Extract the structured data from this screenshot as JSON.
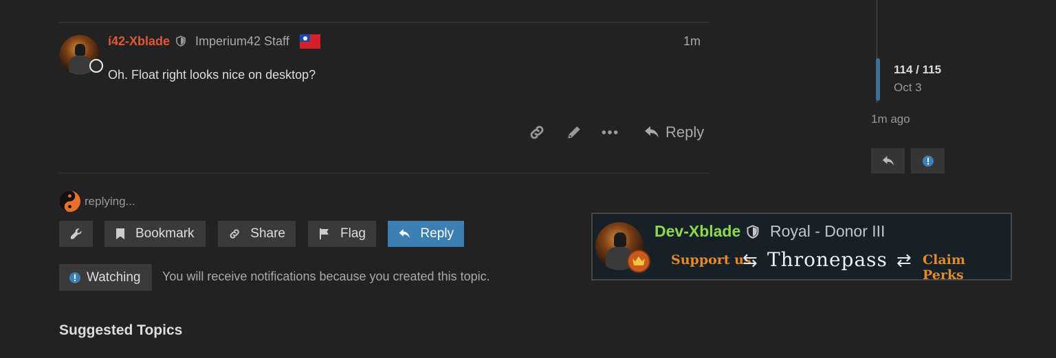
{
  "post": {
    "username": "í42-Xblade",
    "user_title": "Imperium42 Staff",
    "time": "1m",
    "body": "Oh. Float right looks nice on desktop?",
    "actions": {
      "reply_label": "Reply"
    },
    "colors": {
      "username": "#e45735"
    }
  },
  "timeline": {
    "count": "114 / 115",
    "date": "Oct 3",
    "last_activity": "1m ago"
  },
  "composer_status": {
    "text": "replying..."
  },
  "footer_buttons": {
    "bookmark": "Bookmark",
    "share": "Share",
    "flag": "Flag",
    "reply": "Reply",
    "colors": {
      "primary": "#3c80b3"
    }
  },
  "notifications": {
    "level": "Watching",
    "reason": "You will receive notifications because you created this topic."
  },
  "suggested": {
    "heading": "Suggested Topics"
  },
  "banner": {
    "username": "Dev-Xblade",
    "title": "Royal - Donor III",
    "support": "Support us",
    "arrow_left": "⇆",
    "brand": "Thronepass",
    "arrow_right": "⇄",
    "claim": "Claim Perks",
    "colors": {
      "username": "#8cd94b",
      "accent": "#e48a2a"
    }
  }
}
